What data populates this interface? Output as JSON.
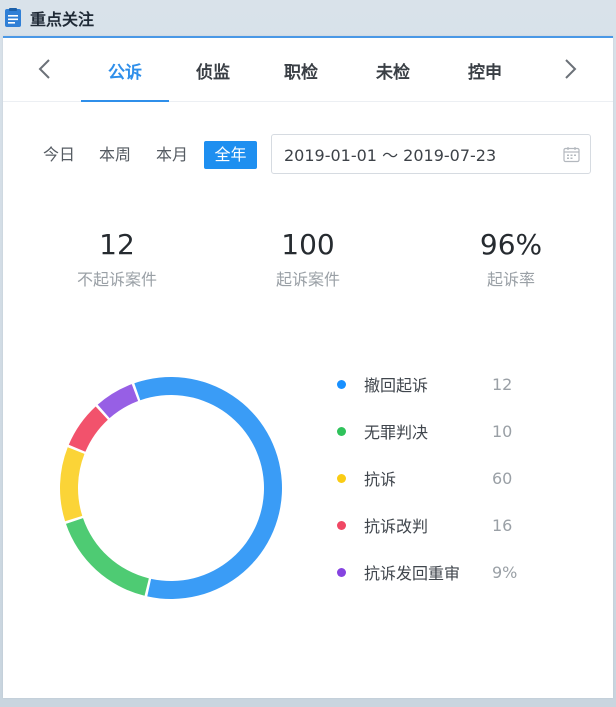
{
  "header": {
    "title": "重点关注",
    "icon": "document-icon"
  },
  "tabs": [
    {
      "label": "公诉",
      "active": true
    },
    {
      "label": "侦监",
      "active": false
    },
    {
      "label": "职检",
      "active": false
    },
    {
      "label": "未检",
      "active": false
    },
    {
      "label": "控申",
      "active": false
    }
  ],
  "ranges": [
    {
      "label": "今日",
      "active": false
    },
    {
      "label": "本周",
      "active": false
    },
    {
      "label": "本月",
      "active": false
    },
    {
      "label": "全年",
      "active": true
    }
  ],
  "date_range": {
    "value": "2019-01-01 ～ 2019-07-23",
    "icon": "calendar-icon"
  },
  "stats": [
    {
      "value": "12",
      "label": "不起诉案件"
    },
    {
      "value": "100",
      "label": "起诉案件"
    },
    {
      "value": "96%",
      "label": "起诉率"
    }
  ],
  "legend": [
    {
      "label": "撤回起诉",
      "value": "12",
      "color": "#1890ff"
    },
    {
      "label": "无罪判决",
      "value": "10",
      "color": "#2fc25b"
    },
    {
      "label": "抗诉",
      "value": "60",
      "color": "#facc14"
    },
    {
      "label": "抗诉改判",
      "value": "16",
      "color": "#f04864"
    },
    {
      "label": "抗诉发回重审",
      "value": "9%",
      "color": "#8543e0"
    }
  ],
  "colors": {
    "accent": "#2f8fea",
    "active_range": "#1e8ff0"
  },
  "chart_data": {
    "type": "pie",
    "variant": "donut",
    "categories": [
      "撤回起诉",
      "无罪判决",
      "抗诉",
      "抗诉改判",
      "抗诉发回重审"
    ],
    "visual_shares": [
      0.58,
      0.16,
      0.11,
      0.07,
      0.06
    ],
    "slice_colors": [
      "#3a9cf6",
      "#4ecb73",
      "#fbd437",
      "#f2526c",
      "#975fe5"
    ]
  }
}
